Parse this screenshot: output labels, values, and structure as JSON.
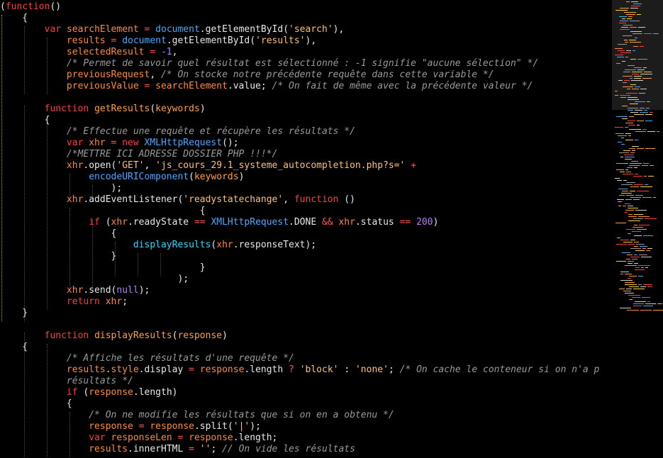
{
  "editor": {
    "lines": [
      [
        [
          "(",
          "pu"
        ],
        [
          "function",
          "kw"
        ],
        [
          "()",
          "pu"
        ]
      ],
      [
        [
          "    {",
          "pu"
        ]
      ],
      [
        [
          "        ",
          "pu"
        ],
        [
          "var",
          "kw"
        ],
        [
          " ",
          "pu"
        ],
        [
          "searchElement",
          "v"
        ],
        [
          " = ",
          "op"
        ],
        [
          "document",
          "obj"
        ],
        [
          ".",
          "pu"
        ],
        [
          "getElementById",
          "pu"
        ],
        [
          "(",
          "pu"
        ],
        [
          "'search'",
          "str"
        ],
        [
          "),",
          "pu"
        ]
      ],
      [
        [
          "            ",
          "pu"
        ],
        [
          "results",
          "v"
        ],
        [
          " = ",
          "op"
        ],
        [
          "document",
          "obj"
        ],
        [
          ".",
          "pu"
        ],
        [
          "getElementById",
          "pu"
        ],
        [
          "(",
          "pu"
        ],
        [
          "'results'",
          "str"
        ],
        [
          "),",
          "pu"
        ]
      ],
      [
        [
          "            ",
          "pu"
        ],
        [
          "selectedResult",
          "v"
        ],
        [
          " = ",
          "op"
        ],
        [
          "-1",
          "num"
        ],
        [
          ",",
          "pu"
        ]
      ],
      [
        [
          "            ",
          "pu"
        ],
        [
          "/* Permet de savoir quel résultat est sélectionné : -1 signifie \"aucune sélection\" */",
          "cm"
        ]
      ],
      [
        [
          "            ",
          "pu"
        ],
        [
          "previousRequest",
          "v"
        ],
        [
          ", ",
          "pu"
        ],
        [
          "/* On stocke notre précédente requête dans cette variable */",
          "cm"
        ]
      ],
      [
        [
          "            ",
          "pu"
        ],
        [
          "previousValue",
          "v"
        ],
        [
          " = ",
          "op"
        ],
        [
          "searchElement",
          "v"
        ],
        [
          ".",
          "pu"
        ],
        [
          "value",
          "pu"
        ],
        [
          "; ",
          "pu"
        ],
        [
          "/* On fait de même avec la précédente valeur */",
          "cm"
        ]
      ],
      [
        [
          "",
          "pu"
        ]
      ],
      [
        [
          "        ",
          "pu"
        ],
        [
          "function",
          "kw"
        ],
        [
          " ",
          "pu"
        ],
        [
          "getResults",
          "fn"
        ],
        [
          "(",
          "pu"
        ],
        [
          "keywords",
          "fn"
        ],
        [
          ")",
          "pu"
        ]
      ],
      [
        [
          "        {",
          "pu"
        ]
      ],
      [
        [
          "            ",
          "pu"
        ],
        [
          "/* Effectue une requête et récupère les résultats */",
          "cm"
        ]
      ],
      [
        [
          "            ",
          "pu"
        ],
        [
          "var",
          "kw"
        ],
        [
          " ",
          "pu"
        ],
        [
          "xhr",
          "v"
        ],
        [
          " = ",
          "op"
        ],
        [
          "new",
          "kw"
        ],
        [
          " ",
          "pu"
        ],
        [
          "XMLHttpRequest",
          "obj"
        ],
        [
          "();",
          "pu"
        ]
      ],
      [
        [
          "            ",
          "pu"
        ],
        [
          "/*METTRE ICI ADRESSE DOSSIER PHP !!!*/",
          "cm"
        ]
      ],
      [
        [
          "            ",
          "pu"
        ],
        [
          "xhr",
          "v"
        ],
        [
          ".",
          "pu"
        ],
        [
          "open",
          "pu"
        ],
        [
          "(",
          "pu"
        ],
        [
          "'GET'",
          "str"
        ],
        [
          ", ",
          "pu"
        ],
        [
          "'js_cours_29.1_systeme_autocompletion.php?s='",
          "str"
        ],
        [
          " + ",
          "op"
        ]
      ],
      [
        [
          "                ",
          "pu"
        ],
        [
          "encodeURIComponent",
          "obj"
        ],
        [
          "(",
          "pu"
        ],
        [
          "keywords",
          "fn"
        ],
        [
          ")",
          "pu"
        ]
      ],
      [
        [
          "                    );",
          "pu"
        ]
      ],
      [
        [
          "            ",
          "pu"
        ],
        [
          "xhr",
          "v"
        ],
        [
          ".",
          "pu"
        ],
        [
          "addEventListener",
          "pu"
        ],
        [
          "(",
          "pu"
        ],
        [
          "'readystatechange'",
          "str"
        ],
        [
          ", ",
          "pu"
        ],
        [
          "function",
          "kw"
        ],
        [
          " ()",
          "pu"
        ]
      ],
      [
        [
          "                                    {",
          "pu"
        ]
      ],
      [
        [
          "                ",
          "pu"
        ],
        [
          "if",
          "kw"
        ],
        [
          " (",
          "pu"
        ],
        [
          "xhr",
          "v"
        ],
        [
          ".",
          "pu"
        ],
        [
          "readyState",
          "pu"
        ],
        [
          " == ",
          "op"
        ],
        [
          "XMLHttpRequest",
          "obj"
        ],
        [
          ".",
          "pu"
        ],
        [
          "DONE",
          "pu"
        ],
        [
          " && ",
          "op"
        ],
        [
          "xhr",
          "v"
        ],
        [
          ".",
          "pu"
        ],
        [
          "status",
          "pu"
        ],
        [
          " == ",
          "op"
        ],
        [
          "200",
          "num"
        ],
        [
          ")",
          "pu"
        ]
      ],
      [
        [
          "                    {",
          "pu"
        ]
      ],
      [
        [
          "                        ",
          "pu"
        ],
        [
          "displayResults",
          "acc"
        ],
        [
          "(",
          "pu"
        ],
        [
          "xhr",
          "v"
        ],
        [
          ".",
          "pu"
        ],
        [
          "responseText",
          "pu"
        ],
        [
          ");",
          "pu"
        ]
      ],
      [
        [
          "                    }",
          "pu"
        ]
      ],
      [
        [
          "                                    }",
          "pu"
        ]
      ],
      [
        [
          "                                );",
          "pu"
        ]
      ],
      [
        [
          "            ",
          "pu"
        ],
        [
          "xhr",
          "v"
        ],
        [
          ".",
          "pu"
        ],
        [
          "send",
          "pu"
        ],
        [
          "(",
          "pu"
        ],
        [
          "null",
          "num"
        ],
        [
          ");",
          "pu"
        ]
      ],
      [
        [
          "            ",
          "pu"
        ],
        [
          "return",
          "kw"
        ],
        [
          " ",
          "pu"
        ],
        [
          "xhr",
          "v"
        ],
        [
          ";",
          "pu"
        ]
      ],
      [
        [
          "    }",
          "pu"
        ]
      ],
      [
        [
          "",
          "pu"
        ]
      ],
      [
        [
          "        ",
          "pu"
        ],
        [
          "function",
          "kw"
        ],
        [
          " ",
          "pu"
        ],
        [
          "displayResults",
          "fn"
        ],
        [
          "(",
          "pu"
        ],
        [
          "response",
          "fn"
        ],
        [
          ")",
          "pu"
        ]
      ],
      [
        [
          "    {",
          "pu"
        ]
      ],
      [
        [
          "            ",
          "pu"
        ],
        [
          "/* Affiche les résultats d'une requête */",
          "cm"
        ]
      ],
      [
        [
          "            ",
          "pu"
        ],
        [
          "results",
          "v"
        ],
        [
          ".",
          "pu"
        ],
        [
          "style",
          "v"
        ],
        [
          ".",
          "pu"
        ],
        [
          "display",
          "pu"
        ],
        [
          " = ",
          "op"
        ],
        [
          "response",
          "v"
        ],
        [
          ".",
          "pu"
        ],
        [
          "length",
          "pu"
        ],
        [
          " ? ",
          "op"
        ],
        [
          "'block'",
          "str"
        ],
        [
          " : ",
          "pu"
        ],
        [
          "'none'",
          "str"
        ],
        [
          "; ",
          "pu"
        ],
        [
          "/* On cache le conteneur si on n'a p",
          "cm"
        ]
      ],
      [
        [
          "            ",
          "pu"
        ],
        [
          "résultats */",
          "cm"
        ]
      ],
      [
        [
          "            ",
          "pu"
        ],
        [
          "if",
          "kw"
        ],
        [
          " (",
          "pu"
        ],
        [
          "response",
          "v"
        ],
        [
          ".",
          "pu"
        ],
        [
          "length",
          "pu"
        ],
        [
          ")",
          "pu"
        ]
      ],
      [
        [
          "            {",
          "pu"
        ]
      ],
      [
        [
          "                ",
          "pu"
        ],
        [
          "/* On ne modifie les résultats que si on en a obtenu */",
          "cm"
        ]
      ],
      [
        [
          "                ",
          "pu"
        ],
        [
          "response",
          "v"
        ],
        [
          " = ",
          "op"
        ],
        [
          "response",
          "v"
        ],
        [
          ".",
          "pu"
        ],
        [
          "split",
          "pu"
        ],
        [
          "(",
          "pu"
        ],
        [
          "'|'",
          "str"
        ],
        [
          ");",
          "pu"
        ]
      ],
      [
        [
          "                ",
          "pu"
        ],
        [
          "var",
          "kw"
        ],
        [
          " ",
          "pu"
        ],
        [
          "responseLen",
          "v"
        ],
        [
          " = ",
          "op"
        ],
        [
          "response",
          "v"
        ],
        [
          ".",
          "pu"
        ],
        [
          "length",
          "pu"
        ],
        [
          ";",
          "pu"
        ]
      ],
      [
        [
          "                ",
          "pu"
        ],
        [
          "results",
          "v"
        ],
        [
          ".",
          "pu"
        ],
        [
          "innerHTML",
          "pu"
        ],
        [
          " = ",
          "op"
        ],
        [
          "''",
          "str"
        ],
        [
          "; ",
          "pu"
        ],
        [
          "// On vide les résultats",
          "cm"
        ]
      ]
    ]
  }
}
